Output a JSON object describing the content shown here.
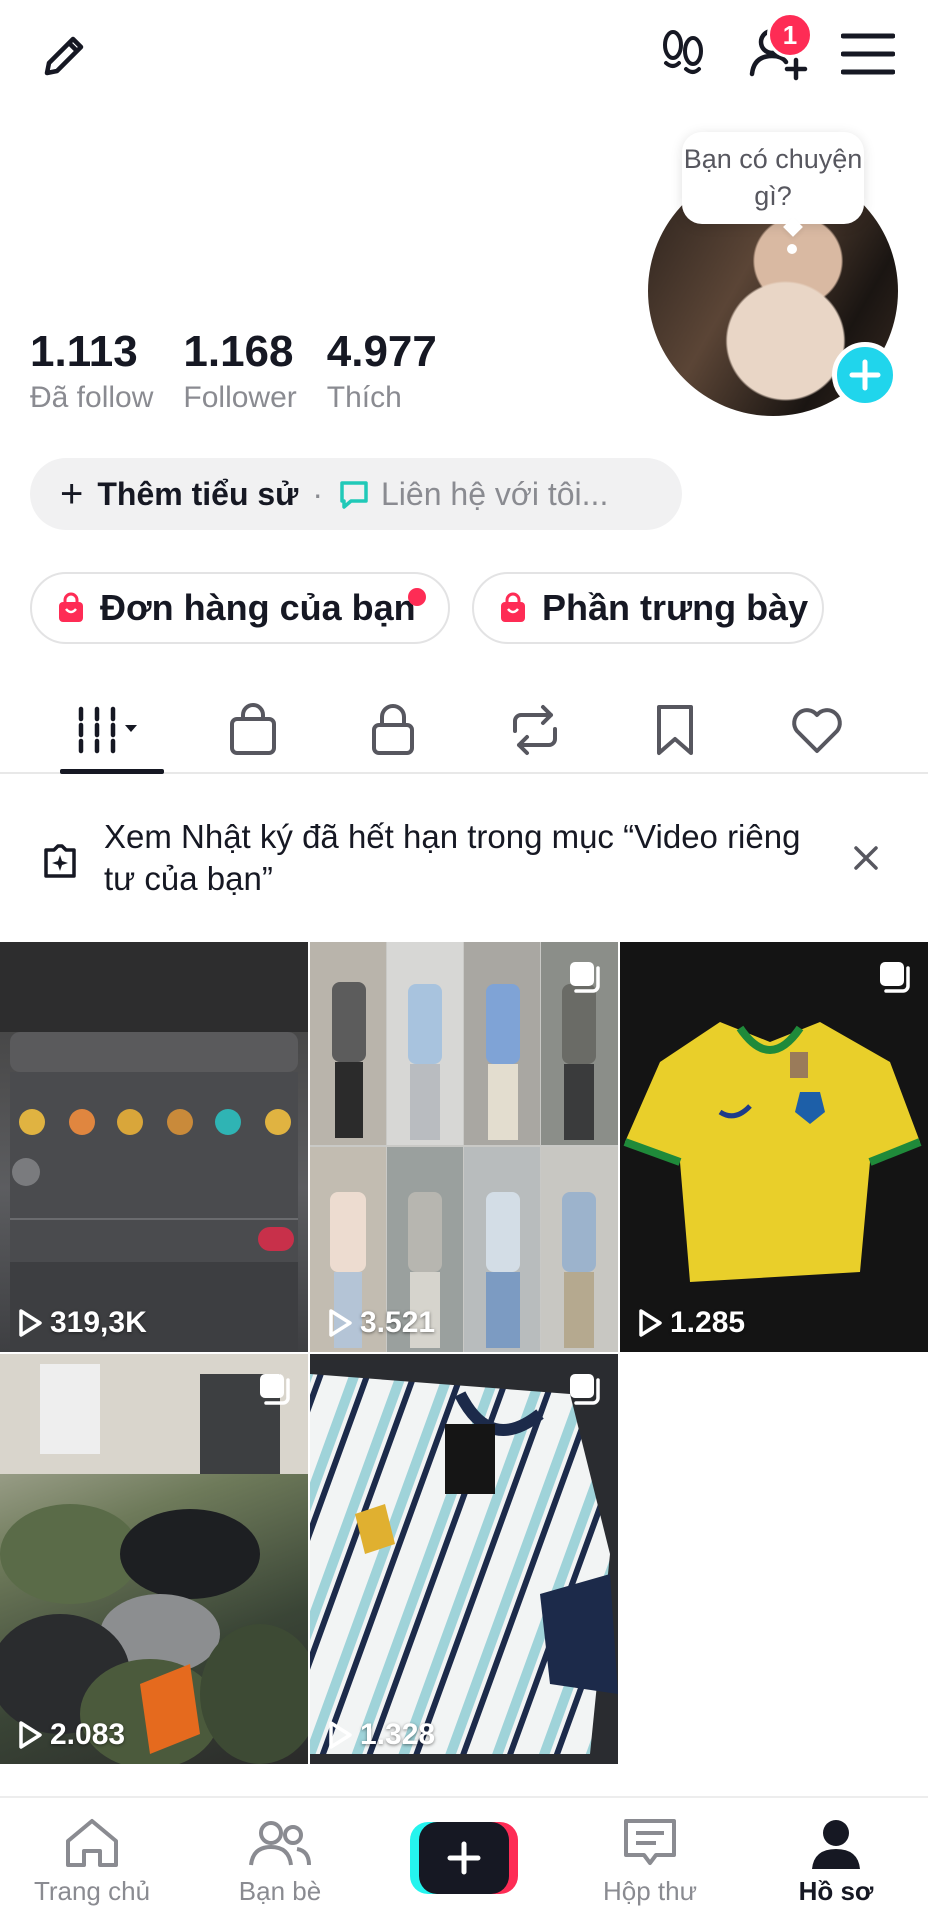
{
  "header": {
    "notification_count": "1"
  },
  "profile": {
    "username": "",
    "avatar_bubble": "Bạn có chuyện gì?",
    "stats": [
      {
        "value": "1.113",
        "label": "Đã follow"
      },
      {
        "value": "1.168",
        "label": "Follower"
      },
      {
        "value": "4.977",
        "label": "Thích"
      }
    ],
    "add_bio": "Thêm tiểu sử",
    "separator": "·",
    "contact": "Liên hệ với tôi..."
  },
  "chips": {
    "orders": "Đơn hàng của bạn",
    "showcase": "Phần trưng bày"
  },
  "tabs": [
    {
      "icon": "grid-icon",
      "active": true
    },
    {
      "icon": "shopping-bag-icon"
    },
    {
      "icon": "lock-icon"
    },
    {
      "icon": "repost-icon"
    },
    {
      "icon": "bookmark-icon"
    },
    {
      "icon": "heart-icon"
    }
  ],
  "notice": {
    "text": "Xem Nhật ký đã hết hạn trong mục “Video riêng tư của bạn”"
  },
  "videos": [
    {
      "views": "319,3K"
    },
    {
      "views": "3.521"
    },
    {
      "views": "1.285"
    },
    {
      "views": "2.083"
    },
    {
      "views": "1.328"
    }
  ],
  "bottom_nav": {
    "home": "Trang chủ",
    "friends": "Bạn bè",
    "inbox": "Hộp thư",
    "profile": "Hồ sơ"
  },
  "colors": {
    "accent_red": "#fe2c55",
    "accent_cyan": "#20d5ec",
    "text_primary": "#161823",
    "text_secondary": "#8a8b91"
  }
}
